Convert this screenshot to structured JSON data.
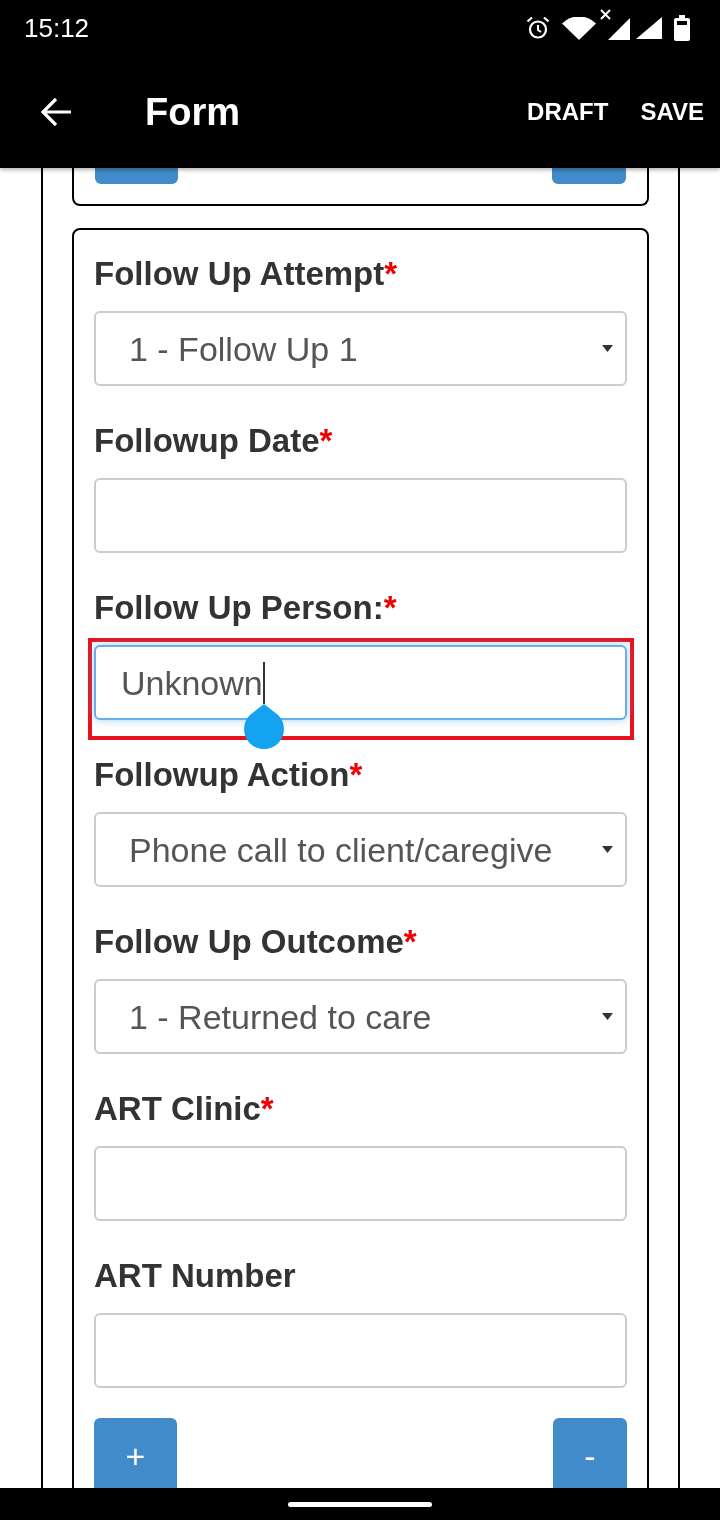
{
  "status_bar": {
    "time": "15:12"
  },
  "app_bar": {
    "title": "Form",
    "actions": [
      "DRAFT",
      "SAVE"
    ]
  },
  "form": {
    "fields": [
      {
        "kind": "select",
        "label": "Follow Up Attempt",
        "required_mark": "*",
        "value": "1 - Follow Up 1",
        "focused": false,
        "highlighted": false
      },
      {
        "kind": "text",
        "label": "Followup Date",
        "required_mark": "*",
        "focused": false,
        "highlighted": false
      },
      {
        "kind": "text",
        "label": "Follow Up Person:",
        "required_mark": "*",
        "value": "Unknown",
        "focused": true,
        "highlighted": true
      },
      {
        "kind": "select",
        "label": "Followup Action",
        "required_mark": "*",
        "value": "Phone call to client/caregive",
        "focused": false,
        "highlighted": false
      },
      {
        "kind": "select",
        "label": "Follow Up Outcome",
        "required_mark": "*",
        "value": "1 - Returned to care",
        "focused": false,
        "highlighted": false
      },
      {
        "kind": "text",
        "label": "ART Clinic",
        "required_mark": "*",
        "focused": false,
        "highlighted": false
      },
      {
        "kind": "text",
        "label": "ART Number",
        "focused": false,
        "highlighted": false
      }
    ],
    "buttons": [
      "+",
      "-"
    ]
  }
}
